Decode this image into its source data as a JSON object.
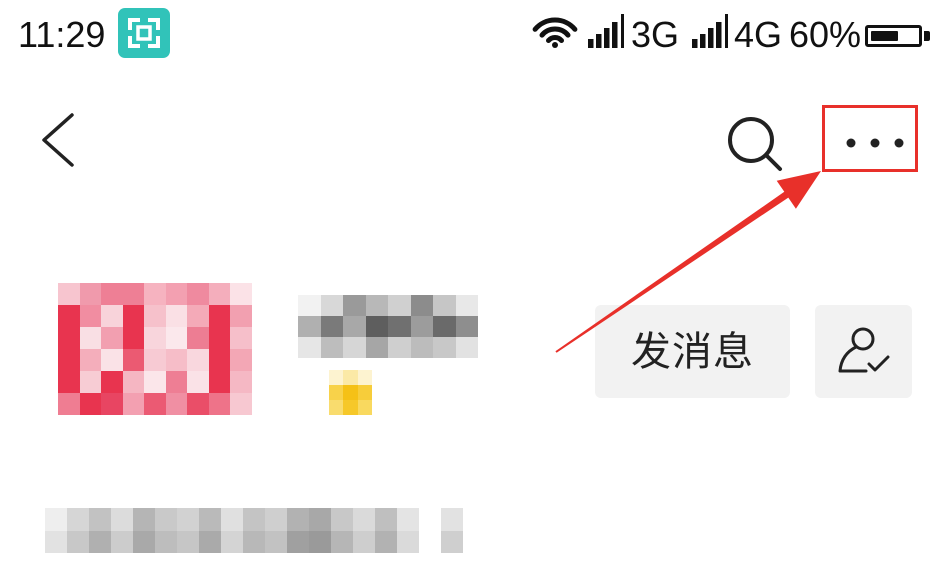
{
  "status_bar": {
    "time": "11:29",
    "network_primary": "3G",
    "network_secondary": "4G",
    "battery_text": "60%",
    "battery_level": 0.6,
    "icons": {
      "notification": "screenshot-icon",
      "wifi": "wifi-icon",
      "signal": "cellular-signal-icon",
      "battery": "battery-icon"
    }
  },
  "nav_bar": {
    "icons": {
      "back": "chevron-left-icon",
      "search": "search-icon",
      "more": "more-horizontal-icon"
    }
  },
  "profile_header": {
    "message_button_label": "发消息",
    "follow_status_icon": "user-check-icon"
  },
  "colors": {
    "annotation": "#e8302a",
    "notification_icon_bg": "#31c3b9",
    "button_bg": "#f2f2f2",
    "text": "#1a1a1a"
  }
}
